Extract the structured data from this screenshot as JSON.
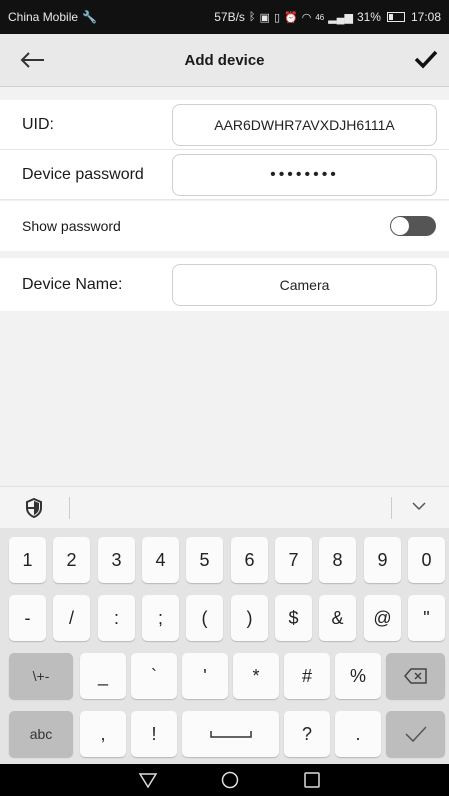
{
  "status": {
    "carrier": "China Mobile",
    "speed": "57B/s",
    "signal": "46",
    "battery": "31%",
    "battery_level": 0.31,
    "time": "17:08"
  },
  "header": {
    "title": "Add device"
  },
  "form": {
    "uid_label": "UID:",
    "uid_value": "AAR6DWHR7AVXDJH6111A",
    "password_label": "Device password",
    "password_value": "••••••••",
    "show_password_label": "Show password",
    "show_password_enabled": false,
    "name_label": "Device Name:",
    "name_value": "Camera"
  },
  "keyboard": {
    "row1": [
      "1",
      "2",
      "3",
      "4",
      "5",
      "6",
      "7",
      "8",
      "9",
      "0"
    ],
    "row2": [
      "-",
      "/",
      ":",
      ";",
      "(",
      ")",
      "$",
      "&",
      "@",
      "\""
    ],
    "row3": [
      "\\+-",
      "_",
      "`",
      "'",
      "*",
      "#",
      "%"
    ],
    "row4": [
      "abc",
      ",",
      "!",
      "?",
      "."
    ]
  },
  "icons": {
    "back": "back-arrow-icon",
    "confirm": "checkmark-icon",
    "shield": "shield-icon",
    "collapse": "chevron-down-icon",
    "backspace": "backspace-icon",
    "space": "space-bar-icon",
    "enter": "checkmark-icon"
  }
}
